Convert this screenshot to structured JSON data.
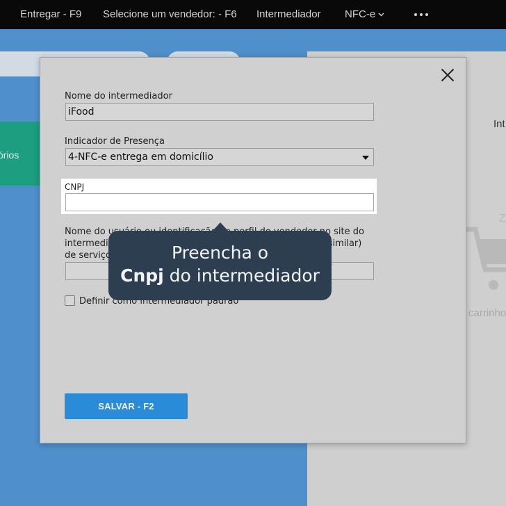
{
  "topbar": {
    "entregar": "Entregar - F9",
    "vendedor": "Selecione um vendedor: - F6",
    "intermediador": "Intermediador",
    "nfce": "NFC-e"
  },
  "background": {
    "teal_card_label": "sórios",
    "right_title": "Int",
    "right_letter": "Z",
    "cart_text": "carrinho"
  },
  "modal": {
    "nome_label": "Nome do intermediador",
    "nome_value": "iFood",
    "indicador_label": "Indicador de Presença",
    "indicador_value": "4-NFC-e entrega em domicílio",
    "cnpj_label": "CNPJ",
    "cnpj_value": "",
    "usuario_label": "Nome do usuário ou identificação do perfil do vendedor no site do intermediador (ex.: apelido, e-mail, ou outro identificador similar) de serviços",
    "usuario_value": "",
    "padrao_label": "Definir como intermediador padrão",
    "padrao_checked": false,
    "save_label": "SALVAR - F2"
  },
  "tooltip": {
    "line1": "Preencha o",
    "bold": "Cnpj",
    "line2_rest": " do intermediador"
  },
  "colors": {
    "topbar": "#090909",
    "accent_blue": "#2a8bd8",
    "tooltip_bg": "#2c3e50",
    "teal": "#1d9e80"
  }
}
